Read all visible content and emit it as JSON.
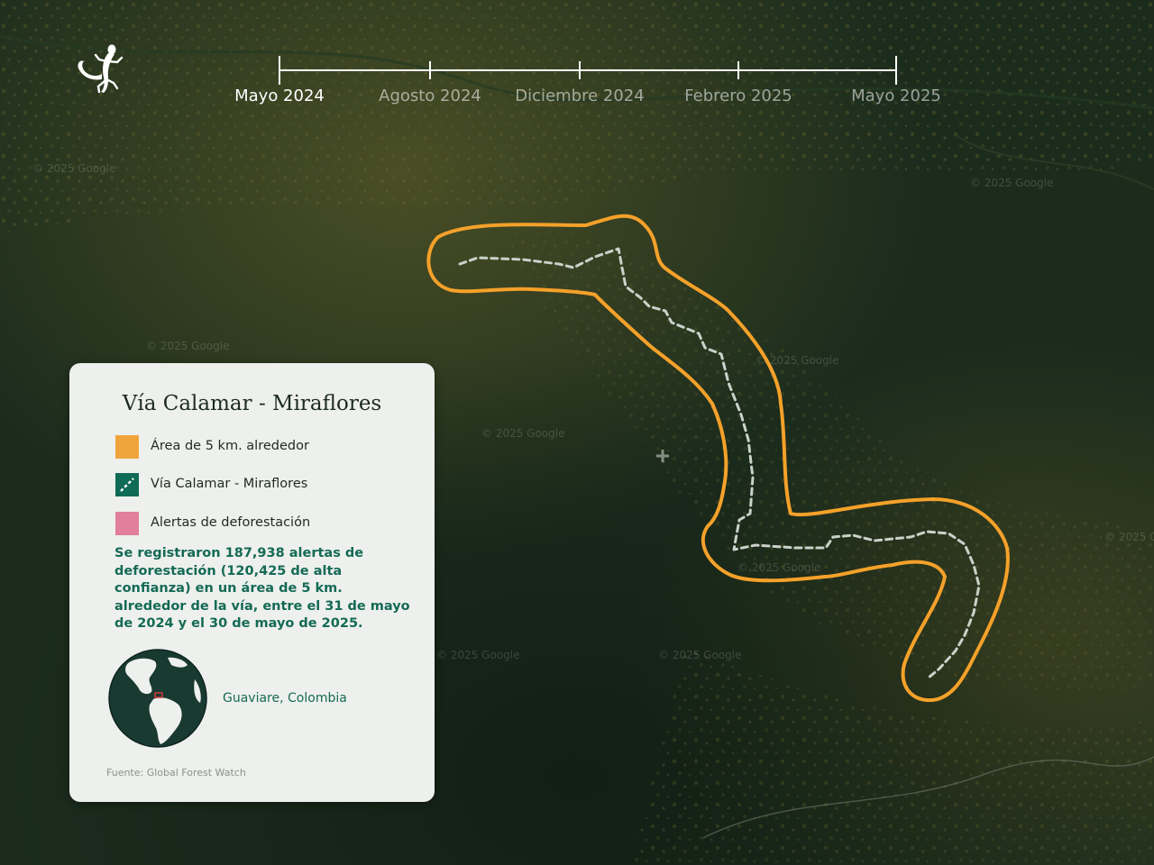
{
  "timeline": {
    "items": [
      {
        "label": "Mayo 2024",
        "active": true
      },
      {
        "label": "Agosto 2024",
        "active": false
      },
      {
        "label": "Diciembre 2024",
        "active": false
      },
      {
        "label": "Febrero 2025",
        "active": false
      },
      {
        "label": "Mayo 2025",
        "active": false
      }
    ]
  },
  "map": {
    "watermark": "© 2025 Google",
    "colors": {
      "buffer": "#f5a12a",
      "road": "#c9d2c9",
      "forest": "#1a2d1c",
      "cleared": "#6b6a33"
    }
  },
  "legend": {
    "title": "Vía Calamar - Miraflores",
    "items": [
      {
        "label": "Área de 5 km. alrededor",
        "color": "#f0a53c",
        "icon": "orange-square"
      },
      {
        "label": "Vía Calamar - Miraflores",
        "color": "#0f6b55",
        "icon": "dashed-road-square"
      },
      {
        "label": "Alertas de deforestación",
        "color": "#e17f9c",
        "icon": "pink-square"
      }
    ],
    "description": "Se registraron 187,938 alertas de deforestación (120,425 de alta confianza) en un área de 5 km. alrededor de la vía, entre el 31 de mayo de 2024 y el 30 de mayo de 2025.",
    "location": "Guaviare, Colombia",
    "source": "Fuente: Global Forest Watch",
    "globe_colors": {
      "ocean": "#183a31",
      "land": "#eef0ed",
      "marker": "#d23a3a"
    }
  },
  "icons": {
    "logo": "gecko-icon",
    "crosshair": "crosshair-icon",
    "globe": "globe-icon"
  }
}
